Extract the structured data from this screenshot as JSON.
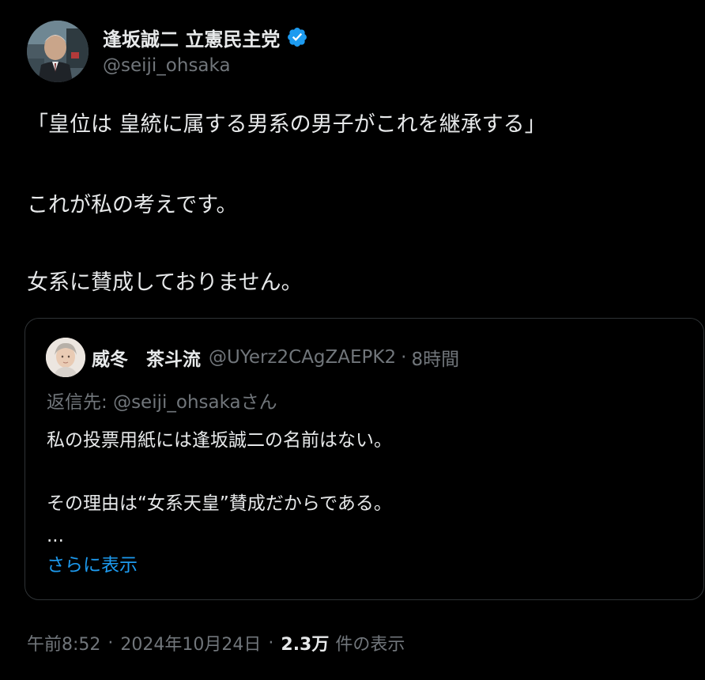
{
  "colors": {
    "background": "#000000",
    "text_primary": "#e7e9ea",
    "text_secondary": "#71767b",
    "accent": "#1d9bf0",
    "border": "#2f3336"
  },
  "author": {
    "name": "逢坂誠二 立憲民主党",
    "handle": "@seiji_ohsaka",
    "verified": true,
    "verified_icon": "verified-badge-icon",
    "avatar_icon": "avatar"
  },
  "tweet": {
    "lines": [
      "「皇位は 皇統に属する男系の男子がこれを継承する」",
      "これが私の考えです。",
      "女系に賛成しておりません。"
    ]
  },
  "quote": {
    "author_name": "威冬　茶斗流",
    "handle": "@UYerz2CAgZAEPK2",
    "separator": "·",
    "time": "8時間",
    "reply_label": "返信先:",
    "reply_handle": "@seiji_ohsaka",
    "reply_suffix": "さん",
    "lines": [
      "私の投票用紙には逢坂誠二の名前はない。",
      "その理由は“女系天皇”賛成だからである。",
      "..."
    ],
    "show_more": "さらに表示"
  },
  "meta": {
    "time": "午前8:52",
    "separator": "·",
    "date": "2024年10月24日",
    "views_count": "2.3万",
    "views_label": "件の表示"
  }
}
